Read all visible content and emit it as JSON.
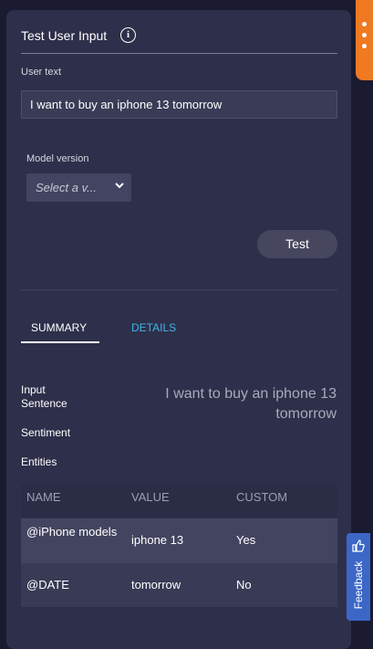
{
  "header": {
    "title": "Test User Input"
  },
  "user_text": {
    "label": "User text",
    "value": "I want to buy an iphone 13 tomorrow"
  },
  "model": {
    "label": "Model version",
    "placeholder": "Select a v..."
  },
  "test_button": {
    "label": "Test"
  },
  "tabs": [
    {
      "label": "SUMMARY"
    },
    {
      "label": "DETAILS"
    }
  ],
  "summary": {
    "input_sentence_label": "Input Sentence",
    "input_sentence_value": "I want to buy an iphone 13 tomorrow",
    "sentiment_label": "Sentiment",
    "entities_label": "Entities"
  },
  "entities_table": {
    "headers": [
      "NAME",
      "VALUE",
      "CUSTOM"
    ],
    "rows": [
      {
        "name": "@iPhone models",
        "value": "iphone 13",
        "custom": "Yes"
      },
      {
        "name": "@DATE",
        "value": "tomorrow",
        "custom": "No"
      }
    ]
  },
  "feedback": {
    "label": "Feedback"
  },
  "colors": {
    "accent_link": "#41b4e6",
    "orange_tab": "#ef7a22",
    "feedback_bg": "#3c67c7"
  }
}
